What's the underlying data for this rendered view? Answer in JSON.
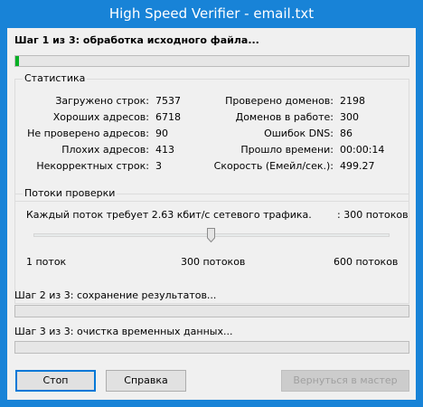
{
  "window": {
    "title": "High Speed Verifier - email.txt"
  },
  "step1": {
    "title": "Шаг 1 из 3: обработка исходного файла...",
    "progress": 0.01
  },
  "stats": {
    "group_title": "Статистика",
    "left": [
      {
        "label": "Загружено строк:",
        "value": "7537"
      },
      {
        "label": "Хороших адресов:",
        "value": "6718"
      },
      {
        "label": "Не проверено адресов:",
        "value": "90"
      },
      {
        "label": "Плохих адресов:",
        "value": "413"
      },
      {
        "label": "Некорректных строк:",
        "value": "3"
      }
    ],
    "right": [
      {
        "label": "Проверено доменов:",
        "value": "2198"
      },
      {
        "label": "Доменов в работе:",
        "value": "300"
      },
      {
        "label": "Ошибок DNS:",
        "value": "86"
      },
      {
        "label": "Прошло времени:",
        "value": "00:00:14"
      },
      {
        "label": "Скорость (Емейл/сек.):",
        "value": "499.27"
      }
    ]
  },
  "threads": {
    "group_title": "Потоки проверки",
    "description": "Каждый поток требует 2.63 кбит/с сетевого трафика.",
    "current": ": 300 потоков",
    "min_label": "1 поток",
    "mid_label": "300 потоков",
    "max_label": "600 потоков",
    "slider_value": 300,
    "slider_min": 1,
    "slider_max": 600
  },
  "step2": {
    "title": "Шаг 2 из 3: сохранение результатов...",
    "progress": 0
  },
  "step3": {
    "title": "Шаг 3 из 3: очистка временных данных...",
    "progress": 0
  },
  "buttons": {
    "stop": "Стоп",
    "help": "Справка",
    "back": "Вернуться в мастер"
  },
  "colors": {
    "titlebar": "#1883d7",
    "progress_fill": "#06b025",
    "client_bg": "#f0f0f0"
  }
}
